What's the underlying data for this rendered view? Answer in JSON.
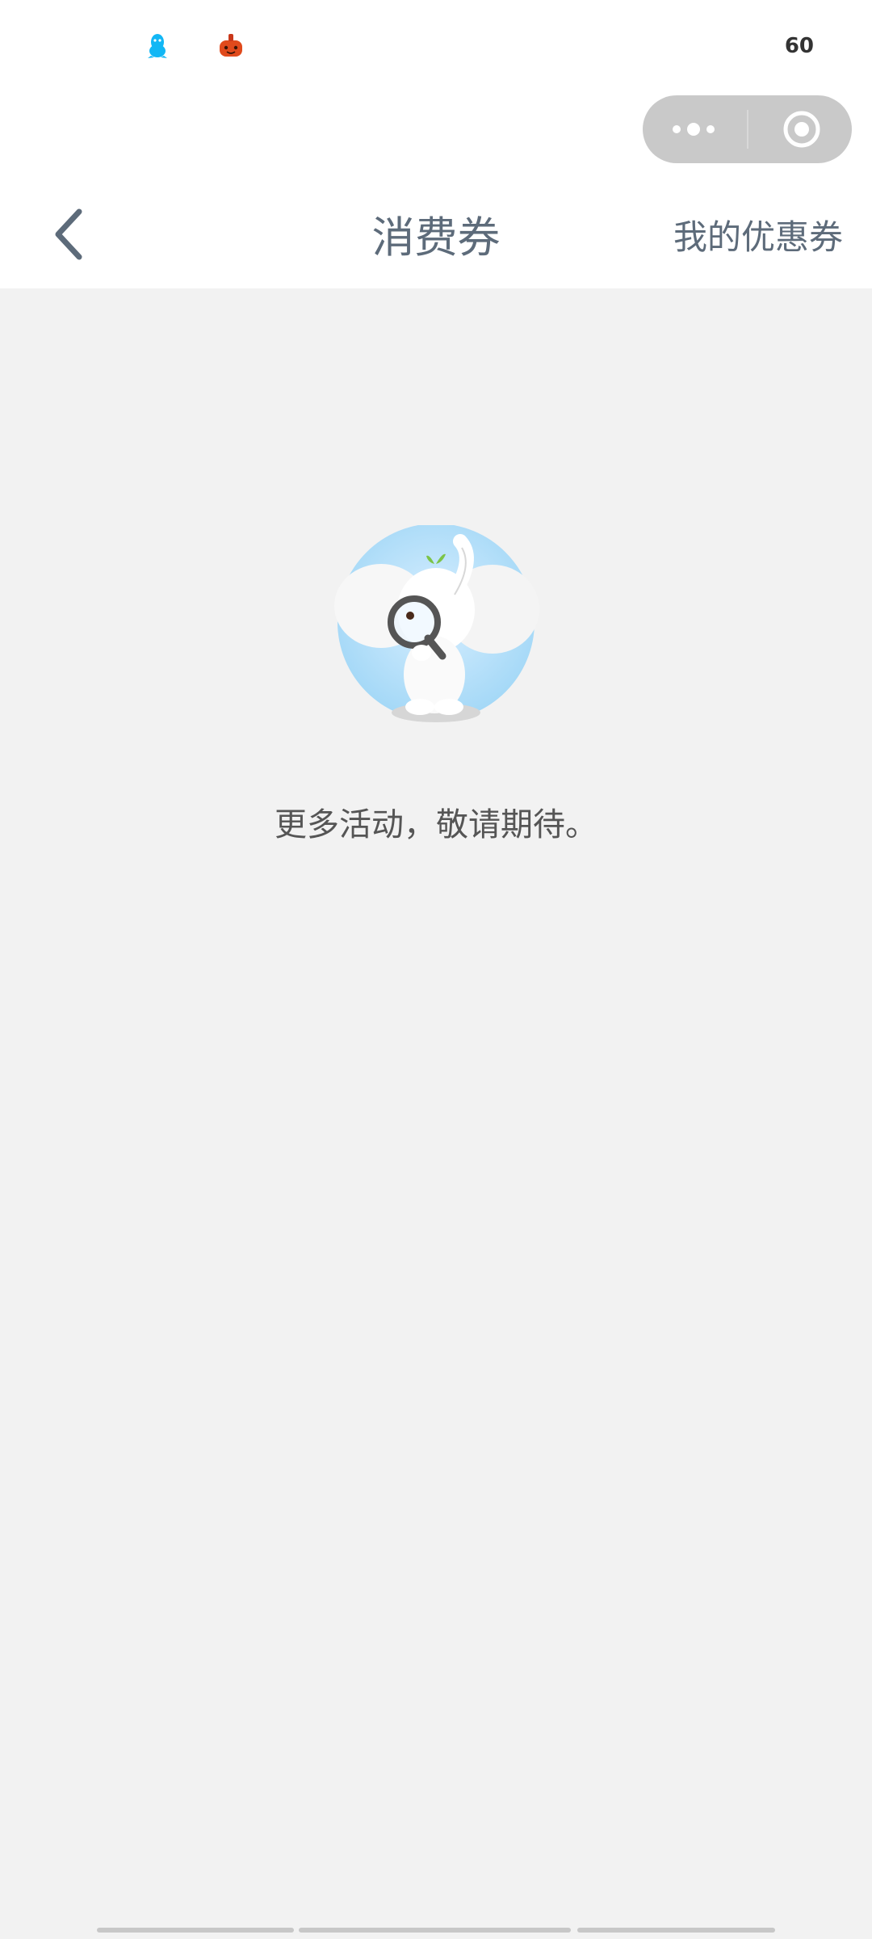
{
  "status_bar": {
    "battery_text": "60",
    "icons": [
      "qq-penguin-icon",
      "red-app-icon"
    ]
  },
  "capsule": {
    "menu_icon": "more-dots-icon",
    "close_icon": "target-circle-icon"
  },
  "navbar": {
    "back_icon": "chevron-left-icon",
    "title": "消费券",
    "right_link": "我的优惠券"
  },
  "empty_state": {
    "illustration": "elephant-with-magnifier-icon",
    "message": "更多活动，敬请期待。"
  },
  "colors": {
    "page_background": "#f2f2f2",
    "nav_text": "#5d6b7a",
    "body_text": "#555555",
    "capsule_background": "#c9c9c9",
    "illustration_circle": "#9fd6f6"
  }
}
